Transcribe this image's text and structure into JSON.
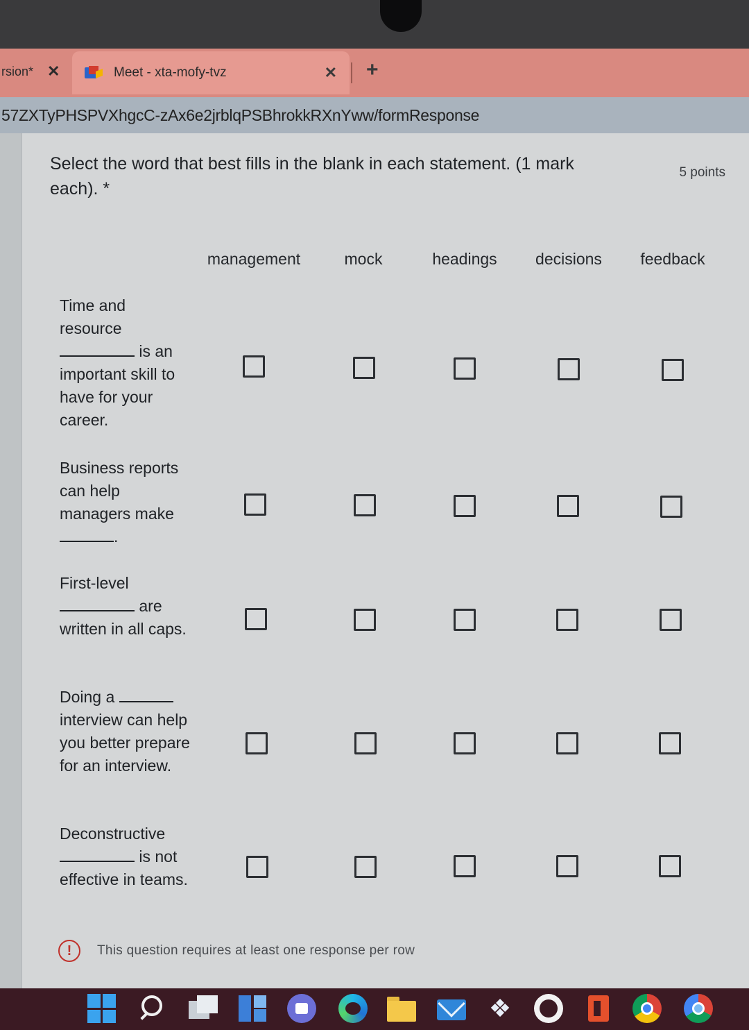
{
  "browser": {
    "prev_tab_title": "rsion*",
    "prev_tab_close": "✕",
    "active_tab_title": "Meet - xta-mofy-tvz",
    "active_tab_close": "✕",
    "new_tab": "+",
    "url": "57ZXTyPHSPVXhgcC-zAx6e2jrblqPSBhrokkRXnYww/formResponse"
  },
  "form": {
    "question": "Select the word that best fills in the blank in each statement. (1 mark each). *",
    "points": "5 points",
    "columns": [
      "management",
      "mock",
      "headings",
      "decisions",
      "feedback"
    ],
    "rows": [
      {
        "before": "Time and resource",
        "after": "is an important skill to have for your career."
      },
      {
        "before": "Business reports can help managers make",
        "after": "."
      },
      {
        "before": "First-level",
        "after": "are written in all caps."
      },
      {
        "before": "Doing a",
        "after": "interview can help you better prepare for an interview."
      },
      {
        "before": "Deconstructive",
        "after": "is not effective in teams."
      }
    ],
    "warning_icon": "!",
    "warning": "This question requires at least one response per row"
  },
  "taskbar": {
    "dropbox_glyph": "❖",
    "icons": [
      "windows-start-icon",
      "search-icon",
      "task-view-icon",
      "widgets-icon",
      "teams-chat-icon",
      "edge-icon",
      "file-explorer-icon",
      "mail-icon",
      "dropbox-icon",
      "github-icon",
      "office-icon",
      "chrome-icon",
      "chrome-profile-icon"
    ]
  },
  "colors": {
    "tab_bar": "#d98980",
    "active_tab": "#e69a91",
    "warning_red": "#c0312b",
    "taskbar": "#3b1a23"
  }
}
